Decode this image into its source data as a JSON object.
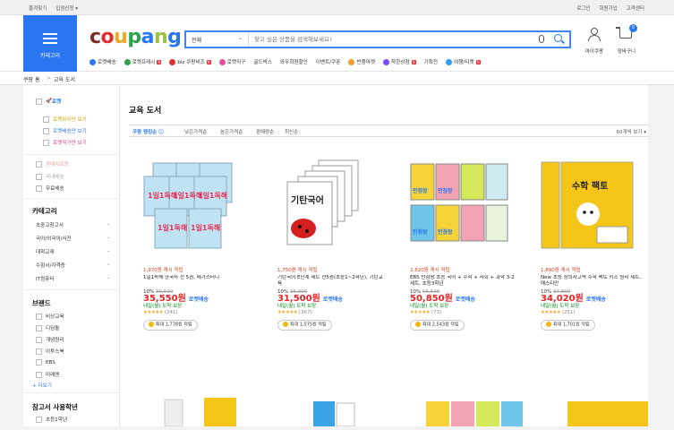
{
  "topbar": {
    "left": [
      "즐겨찾기",
      "입점신청 ▾"
    ],
    "right": [
      "로그인",
      "회원가입",
      "고객센터"
    ]
  },
  "header": {
    "category_label": "카테고리",
    "logo": "coupang",
    "logo_colors": [
      "#7b2d26",
      "#e02d2d",
      "#f6a623",
      "#2ba24c",
      "#2a76f0",
      "#9ac43c",
      "#2a76f0"
    ],
    "search": {
      "select": "전체",
      "placeholder": "찾고 싶은 상품을 검색해보세요!"
    },
    "mycoupang": "마이쿠팡",
    "cart": "장바구니",
    "cart_count": "0"
  },
  "nav": [
    {
      "label": "로켓배송",
      "color": "#2a76f0"
    },
    {
      "label": "로켓프레시",
      "color": "#2ba24c",
      "badge": "N"
    },
    {
      "label": "biz 쿠팡비즈",
      "color": "#e02d2d",
      "badge": "N"
    },
    {
      "label": "로켓직구",
      "color": "#e84ca0"
    },
    {
      "label": "골드박스",
      "color": ""
    },
    {
      "label": "와우회원할인",
      "color": ""
    },
    {
      "label": "이벤트/쿠폰",
      "color": ""
    },
    {
      "label": "반품마켓",
      "color": "#f29b30"
    },
    {
      "label": "착한상점",
      "color": "#7c4dff",
      "badge": "N"
    },
    {
      "label": "기획전",
      "color": ""
    },
    {
      "label": "여행/티켓",
      "color": "#2a9df4",
      "badge": "N"
    }
  ],
  "breadcrumb": [
    "쿠팡 홈",
    ">",
    "교육 도서"
  ],
  "sidebar": {
    "rocket": "로켓",
    "rocket_opts": [
      "로켓와우만 보기",
      "로켓배송만 보기",
      "로켓직구만 보기"
    ],
    "more_opts": [
      "판매자로켓",
      "국내배송",
      "무료배송"
    ],
    "cat_title": "카테고리",
    "cats": [
      "초중고참고서",
      "국어/외국어/사전",
      "대학교재",
      "수험서/자격증",
      "IT컴퓨터"
    ],
    "brand_title": "브랜드",
    "brands": [
      "비상교육",
      "디딤돌",
      "개념원리",
      "이투스북",
      "EBS",
      "미래엔"
    ],
    "more": "+ 더보기",
    "grade_title": "참고서 사용학년",
    "grades": [
      "초등1학년"
    ]
  },
  "main": {
    "title": "교육 도서",
    "sorts": [
      "쿠팡 랭킹순 ⓘ",
      "낮은가격순",
      "높은가격순",
      "판매량순",
      "최신순"
    ],
    "per_page": "60개씩 보기 ▾",
    "products": [
      {
        "cash": "1,970원 캐시 적립",
        "name": "1일1독해 한국사 전 5권, 메가스터디",
        "disc": "10%",
        "orig": "39,500",
        "price": "35,550원",
        "badge": "로켓배송",
        "delivery": "내일(월) 도착 보장",
        "stars": "★★★★★",
        "reviews": "(241)",
        "pill": "최대 1,778원 적립"
      },
      {
        "cash": "1,750원 캐시 적립",
        "name": "기탄국어 E단계 세트 전5권(초등1~2학년), 기탄교육",
        "disc": "10%",
        "orig": "35,000",
        "price": "31,500원",
        "badge": "로켓배송",
        "delivery": "내일(월) 도착 보장",
        "stars": "★★★★★",
        "reviews": "(367)",
        "pill": "최대 1,575원 적립"
      },
      {
        "cash": "2,820원 캐시 적립",
        "name": "EBS 만점왕 초등 국어 + 수학 + 사회 + 과학 3-2 세트, 초등3학년",
        "disc": "10%",
        "orig": "56,500",
        "price": "50,850원",
        "badge": "로켓배송",
        "delivery": "내일(월) 도착 보장",
        "stars": "★★★★★",
        "reviews": "(73)",
        "pill": "최대 2,543원 적립"
      },
      {
        "cash": "1,890원 캐시 적립",
        "name": "New 초등 창의사고력 수학 팩토 키즈 원리 세트, 매스티안",
        "disc": "10%",
        "orig": "37,800",
        "price": "34,020원",
        "badge": "로켓배송",
        "delivery": "내일(월) 도착 보장",
        "stars": "★★★★★",
        "reviews": "(251)",
        "pill": "최대 1,701원 적립"
      }
    ],
    "thumb_text": [
      "1일1독해",
      "기탄국어",
      "만점왕",
      "수학 팩토"
    ]
  }
}
